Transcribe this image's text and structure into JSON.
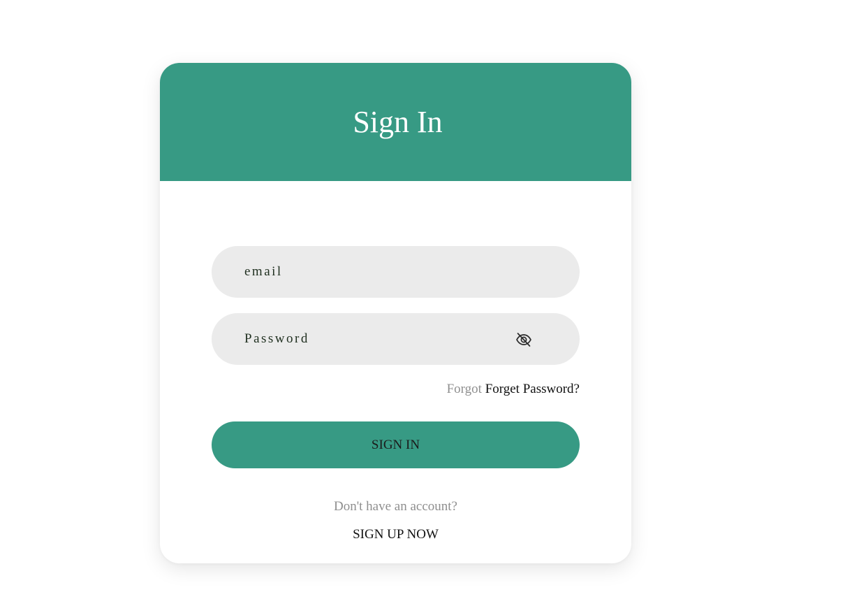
{
  "header": {
    "title": "Sign In"
  },
  "form": {
    "email": {
      "placeholder": "email",
      "value": ""
    },
    "password": {
      "placeholder": "Password",
      "value": "",
      "toggle_icon": "eye-off-icon"
    },
    "forgot": {
      "prefix": "Forgot",
      "link": "Forget Password?"
    },
    "submit_label": "SIGN IN"
  },
  "footer": {
    "prompt": "Don't have an account?",
    "signup_label": "SIGN UP NOW"
  },
  "colors": {
    "accent": "#379a84",
    "field_bg": "#ebebeb",
    "muted_text": "#8f8f8f"
  }
}
